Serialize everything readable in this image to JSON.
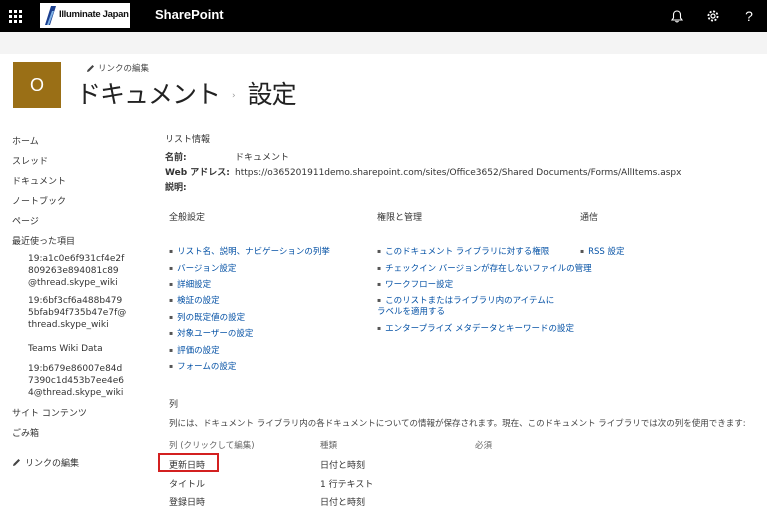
{
  "suite_bar": {
    "logo_text": "Illuminate Japan",
    "app_title": "SharePoint",
    "icons": [
      "waffle-icon",
      "bell-icon",
      "gear-icon",
      "help-icon"
    ],
    "help_glyph": "?"
  },
  "header": {
    "site_logo_letter": "O",
    "edit_links": "リンクの編集",
    "title_part1": "ドキュメント",
    "breadcrumb_separator": "›",
    "title_part2": "設定"
  },
  "left_nav": {
    "items": [
      {
        "label": "ホーム"
      },
      {
        "label": "スレッド"
      },
      {
        "label": "ドキュメント"
      },
      {
        "label": "ノートブック"
      },
      {
        "label": "ページ"
      },
      {
        "label": "最近使った項目"
      }
    ],
    "recent": [
      {
        "label": "19:a1c0e6f931cf4e2f\n809263e894081c89\n@thread.skype_wiki"
      },
      {
        "label": "19:6bf3cf6a488b479\n5bfab94f735b47e7f@\nthread.skype_wiki"
      },
      {
        "label": "Teams Wiki Data"
      },
      {
        "label": "19:b679e86007e84d\n7390c1d453b7ee4e6\n4@thread.skype_wiki"
      }
    ],
    "site_contents": "サイト コンテンツ",
    "recycle_bin": "ごみ箱",
    "edit_links": "リンクの編集"
  },
  "list_info": {
    "heading": "リスト情報",
    "name_label": "名前:",
    "name_value": "ドキュメント",
    "web_label": "Web アドレス:",
    "web_value": "https://o365201911demo.sharepoint.com/sites/Office3652/Shared Documents/Forms/AllItems.aspx",
    "desc_label": "説明:"
  },
  "general": {
    "heading": "全般設定",
    "links": [
      "リスト名、説明、ナビゲーションの列挙",
      "バージョン設定",
      "詳細設定",
      "検証の設定",
      "列の既定値の設定",
      "対象ユーザーの設定",
      "評価の設定",
      "フォームの設定"
    ]
  },
  "permissions": {
    "heading": "権限と管理",
    "links": [
      "このドキュメント ライブラリに対する権限",
      "チェックイン バージョンが存在しないファイルの管理",
      "ワークフロー設定",
      "このリストまたはライブラリ内のアイテムにラベルを適用する",
      "エンタープライズ メタデータとキーワードの設定"
    ]
  },
  "communications": {
    "heading": "通信",
    "links": [
      "RSS 設定"
    ]
  },
  "columns": {
    "heading": "列",
    "description": "列には、ドキュメント ライブラリ内の各ドキュメントについての情報が保存されます。現在、このドキュメント ライブラリでは次の列を使用できます:",
    "headers": {
      "name": "列 (クリックして編集)",
      "type": "種類",
      "required": "必須"
    },
    "rows": [
      {
        "name": "更新日時",
        "type": "日付と時刻"
      },
      {
        "name": "タイトル",
        "type": "1 行テキスト"
      },
      {
        "name": "登録日時",
        "type": "日付と時刻"
      }
    ]
  },
  "colors": {
    "suite_bar": "#000000",
    "site_logo": "#9a6f16",
    "link": "#0451a5",
    "highlight": "#d32020"
  }
}
